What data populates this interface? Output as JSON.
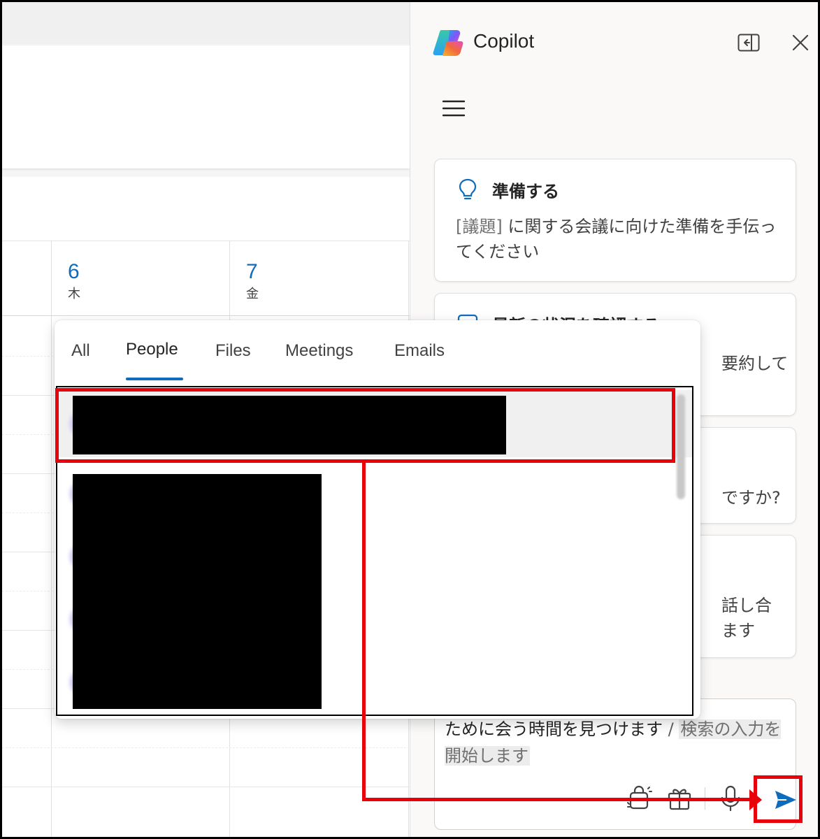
{
  "calendar": {
    "days": [
      {
        "number": "6",
        "weekday": "木"
      },
      {
        "number": "7",
        "weekday": "金"
      }
    ]
  },
  "copilot": {
    "title": "Copilot",
    "header_icons": [
      "side-by-side-icon",
      "close-icon"
    ],
    "menu_icon": "hamburger-menu-icon",
    "cards": [
      {
        "icon": "lightbulb-icon",
        "title": "準備する",
        "body_token": "[議題]",
        "body_text": " に関する会議に向けた準備を手伝ってください"
      },
      {
        "icon": "calendar-list-icon",
        "title": "最新の状況を確認する",
        "visible_tail": "要約して"
      },
      {
        "visible_tail": "ですか?"
      },
      {
        "visible_tail_1": "話し合",
        "visible_tail_2": "ます"
      }
    ],
    "composer": {
      "text": "ために会う時間を見つけます",
      "separator": " / ",
      "placeholder": "検索の入力を開始します",
      "tool_icons": [
        "attach-icon",
        "gift-icon",
        "microphone-icon"
      ],
      "send_icon": "send-icon"
    }
  },
  "picker": {
    "tabs": [
      "All",
      "People",
      "Files",
      "Meetings",
      "Emails"
    ],
    "active_tab": "People"
  },
  "colors": {
    "accent": "#0f6cbd",
    "annotation": "#e8000b",
    "pane_bg": "#faf9f8"
  }
}
